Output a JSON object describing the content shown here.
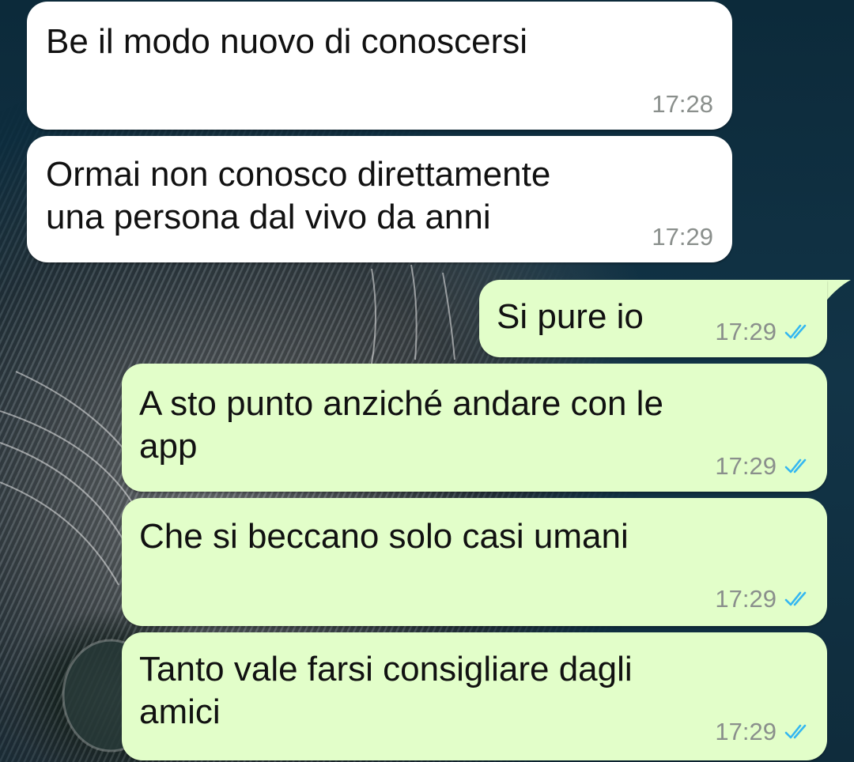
{
  "messages": [
    {
      "direction": "incoming",
      "text": "Be il modo nuovo di conoscersi",
      "time": "17:28"
    },
    {
      "direction": "incoming",
      "text": "Ormai non conosco direttamente\nuna persona dal vivo da anni",
      "time": "17:29"
    },
    {
      "direction": "outgoing",
      "text": "Si pure io",
      "time": "17:29",
      "status_icon": "double-check-read-icon"
    },
    {
      "direction": "outgoing",
      "text": "A sto punto anziché andare con le\napp",
      "time": "17:29",
      "status_icon": "double-check-read-icon"
    },
    {
      "direction": "outgoing",
      "text": "Che si beccano solo casi umani",
      "time": "17:29",
      "status_icon": "double-check-read-icon"
    },
    {
      "direction": "outgoing",
      "text": "Tanto vale farsi consigliare dagli\namici",
      "time": "17:29",
      "status_icon": "double-check-read-icon"
    }
  ],
  "colors": {
    "incoming_bubble": "#ffffff",
    "outgoing_bubble": "#e2fec9",
    "timestamp": "#8a8f8c",
    "read_ticks": "#34b7f1",
    "wallpaper": "#0f2c3c"
  }
}
